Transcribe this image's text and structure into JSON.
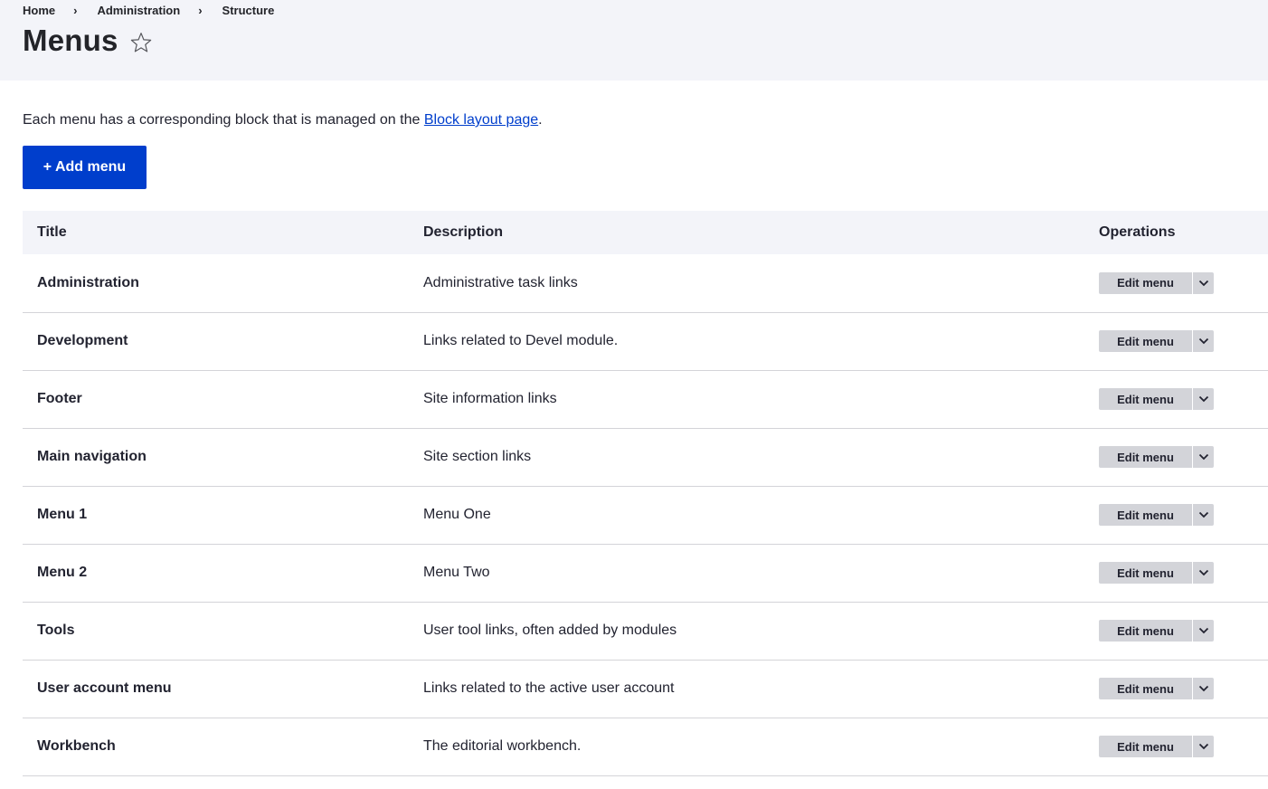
{
  "breadcrumb": [
    {
      "label": "Home"
    },
    {
      "label": "Administration"
    },
    {
      "label": "Structure"
    }
  ],
  "breadcrumb_separator": "›",
  "page_title": "Menus",
  "help": {
    "prefix": "Each menu has a corresponding block that is managed on the ",
    "link_text": "Block layout page",
    "suffix": "."
  },
  "add_button_label": "+ Add menu",
  "table": {
    "headers": {
      "title": "Title",
      "description": "Description",
      "operations": "Operations"
    },
    "rows": [
      {
        "title": "Administration",
        "description": "Administrative task links",
        "op": "Edit menu"
      },
      {
        "title": "Development",
        "description": "Links related to Devel module.",
        "op": "Edit menu"
      },
      {
        "title": "Footer",
        "description": "Site information links",
        "op": "Edit menu"
      },
      {
        "title": "Main navigation",
        "description": "Site section links",
        "op": "Edit menu"
      },
      {
        "title": "Menu 1",
        "description": "Menu One",
        "op": "Edit menu"
      },
      {
        "title": "Menu 2",
        "description": "Menu Two",
        "op": "Edit menu"
      },
      {
        "title": "Tools",
        "description": "User tool links, often added by modules",
        "op": "Edit menu"
      },
      {
        "title": "User account menu",
        "description": "Links related to the active user account",
        "op": "Edit menu"
      },
      {
        "title": "Workbench",
        "description": "The editorial workbench.",
        "op": "Edit menu"
      }
    ]
  },
  "colors": {
    "primary": "#003ecc",
    "header_bg": "#f3f4f9",
    "button_gray": "#d3d4d9",
    "text": "#222330"
  }
}
